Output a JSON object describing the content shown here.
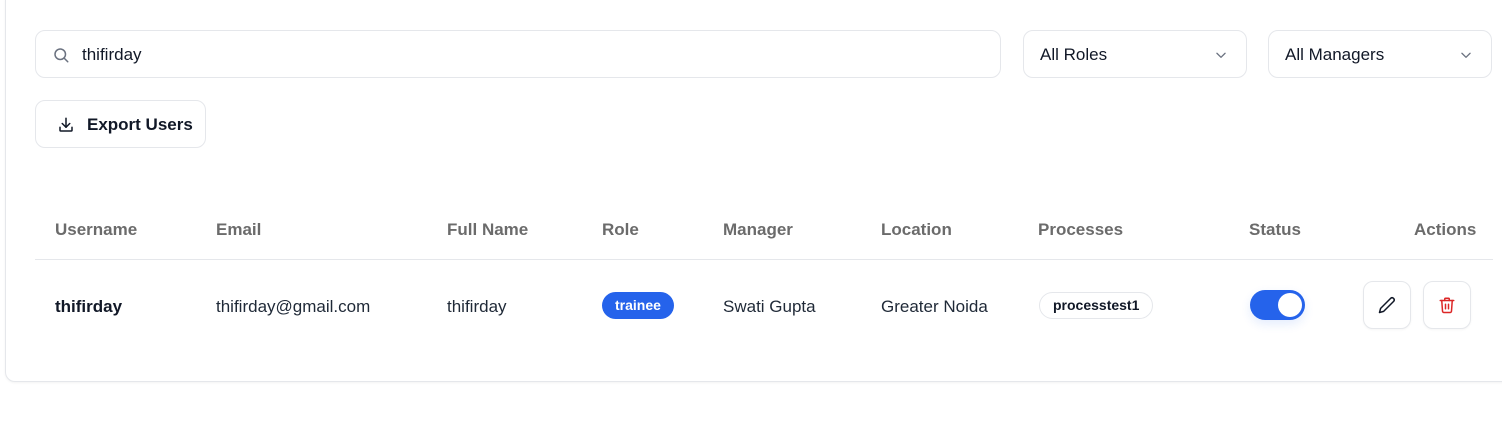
{
  "filters": {
    "search": {
      "value": "thifirday",
      "icon": "search-icon"
    },
    "role_select": {
      "selected": "All Roles"
    },
    "manager_select": {
      "selected": "All Managers"
    }
  },
  "toolbar": {
    "export_label": "Export Users",
    "export_icon": "download-icon"
  },
  "table": {
    "columns": [
      "Username",
      "Email",
      "Full Name",
      "Role",
      "Manager",
      "Location",
      "Processes",
      "Status",
      "Actions"
    ],
    "rows": [
      {
        "username": "thifirday",
        "email": "thifirday@gmail.com",
        "full_name": "thifirday",
        "role": "trainee",
        "manager": "Swati Gupta",
        "location": "Greater Noida",
        "processes": [
          "processtest1"
        ],
        "status_active": true
      }
    ]
  },
  "colors": {
    "accent": "#2563eb",
    "delete": "#dc2626",
    "border": "#e5e7eb",
    "header_text": "#6b6b6b"
  }
}
